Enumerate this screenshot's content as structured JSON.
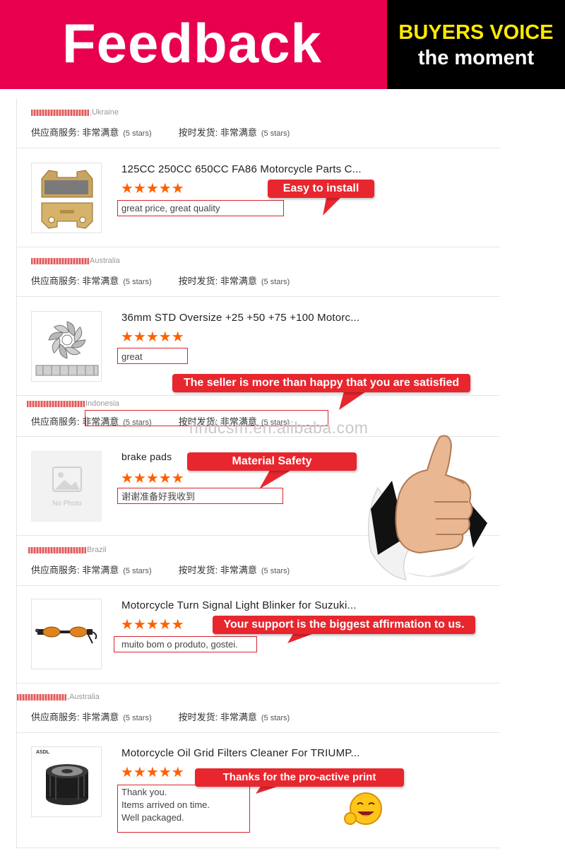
{
  "header": {
    "title": "Feedback",
    "side_line1": "BUYERS VOICE",
    "side_line2": "the moment",
    "colors": {
      "banner_left": "#e8004f",
      "banner_right": "#000000",
      "side_line1": "#ffea00"
    }
  },
  "ratings": {
    "supplier_label": "供应商服务:",
    "supplier_value": "非常满意",
    "shipping_label": "按时发货:",
    "shipping_value": "非常满意",
    "stars_text": "(5 stars)"
  },
  "reviews": [
    {
      "country": "Ukraine",
      "product": "125CC 250CC 650CC FA86 Motorcycle Parts C...",
      "stars": "★★★★★",
      "comment": "great price, great quality",
      "thumb_icon": "brake-pad-image"
    },
    {
      "country": "Australia",
      "product": "36mm STD Oversize +25 +50 +75 +100 Motorc...",
      "stars": "★★★★★",
      "comment": "great",
      "thumb_icon": "piston-ring-image"
    },
    {
      "country": "Indonesia",
      "product": "brake pads",
      "stars": "★★★★★",
      "comment": "谢谢准备好我收到",
      "thumb_icon": "no-photo-image",
      "thumb_text": "No Photo"
    },
    {
      "country": "Brazil",
      "product": "Motorcycle Turn Signal Light Blinker for Suzuki...",
      "stars": "★★★★★",
      "comment": "muito bom o produto, gostei.",
      "thumb_icon": "turn-signal-image"
    },
    {
      "country": "Australia",
      "product": "Motorcycle Oil Grid Filters Cleaner For TRIUMP...",
      "stars": "★★★★★",
      "comment": "Thank you.\nItems arrived on time.\nWell packaged.",
      "thumb_icon": "oil-filter-image",
      "thumb_text": "ASDL"
    }
  ],
  "callouts": [
    "Easy to install",
    "The seller is more than happy that you are satisfied",
    "Material Safety",
    "Your support is the biggest affirmation to us.",
    "Thanks for the pro-active print"
  ],
  "watermark": "hndcsm.en.alibaba.com",
  "decor": {
    "thumbs_up": "thumbs-up-image",
    "smiley": "smiley-emoji"
  },
  "accent_color": "#e8262e",
  "star_color": "#ff6000"
}
